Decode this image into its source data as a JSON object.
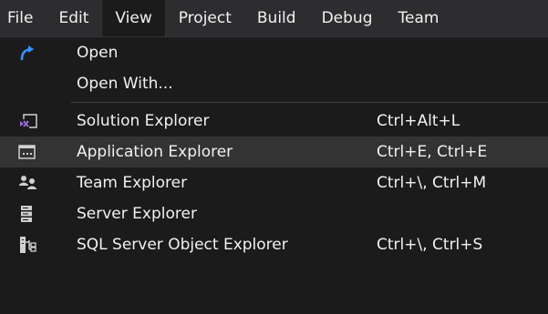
{
  "menubar": {
    "items": [
      "File",
      "Edit",
      "View",
      "Project",
      "Build",
      "Debug",
      "Team"
    ],
    "active": "View"
  },
  "dropdown": {
    "items": [
      {
        "label": "Open",
        "shortcut": "",
        "icon": "redo-arrow-icon"
      },
      {
        "label": "Open With...",
        "shortcut": "",
        "icon": ""
      },
      {
        "label": "Solution Explorer",
        "shortcut": "Ctrl+Alt+L",
        "icon": "solution-explorer-icon"
      },
      {
        "label": "Application Explorer",
        "shortcut": "Ctrl+E, Ctrl+E",
        "icon": "application-explorer-icon"
      },
      {
        "label": "Team Explorer",
        "shortcut": "Ctrl+\\, Ctrl+M",
        "icon": "team-explorer-icon"
      },
      {
        "label": "Server Explorer",
        "shortcut": "",
        "icon": "server-explorer-icon"
      },
      {
        "label": "SQL Server Object Explorer",
        "shortcut": "Ctrl+\\, Ctrl+S",
        "icon": "sql-server-object-explorer-icon"
      }
    ],
    "highlighted_item": "Application Explorer"
  },
  "colors": {
    "background": "#1b1b1c",
    "menubar": "#2d2d30",
    "highlight": "#333334",
    "accent_blue": "#3794ff",
    "vs_purple": "#9b6bd6"
  }
}
